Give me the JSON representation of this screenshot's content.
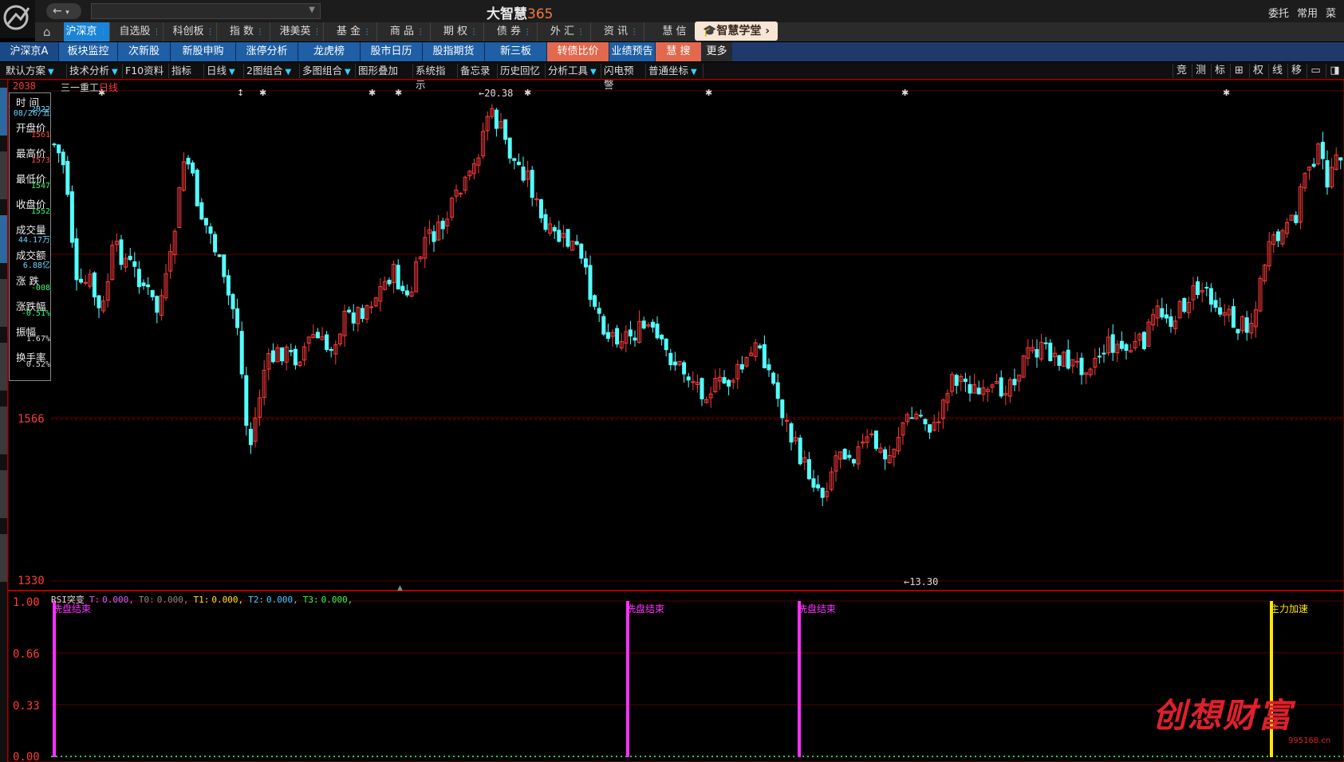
{
  "window": {
    "title_main": "大智慧",
    "title_num": "365",
    "right_links": [
      "委托",
      "常用",
      "菜单"
    ],
    "nav_arrow": "←"
  },
  "market_tabs": [
    {
      "label": "沪深京",
      "active": true
    },
    {
      "label": "自选股",
      "active": false
    },
    {
      "label": "科创板",
      "active": false
    },
    {
      "label": "指  数",
      "active": false
    },
    {
      "label": "港美英",
      "active": false
    },
    {
      "label": "基  金",
      "active": false
    },
    {
      "label": "商  品",
      "active": false
    },
    {
      "label": "期  权",
      "active": false
    },
    {
      "label": "债  券",
      "active": false
    },
    {
      "label": "外  汇",
      "active": false
    },
    {
      "label": "资  讯",
      "active": false
    },
    {
      "label": "慧  信",
      "active": false
    }
  ],
  "academy_button": "智慧学堂",
  "board_tabs": [
    {
      "label": "沪深京A",
      "style": "first"
    },
    {
      "label": "板块监控",
      "style": ""
    },
    {
      "label": "次新股",
      "style": ""
    },
    {
      "label": "新股申购",
      "style": ""
    },
    {
      "label": "涨停分析",
      "style": ""
    },
    {
      "label": "龙虎榜",
      "style": ""
    },
    {
      "label": "股市日历",
      "style": ""
    },
    {
      "label": "股指期货",
      "style": ""
    },
    {
      "label": "新三板",
      "style": ""
    },
    {
      "label": "转债比价",
      "style": "hl"
    },
    {
      "label": "业绩预告",
      "style": ""
    },
    {
      "label": "慧  搜",
      "style": "hl"
    },
    {
      "label": "更多",
      "style": "dark"
    }
  ],
  "tools": [
    {
      "label": "默认方案",
      "tri": true
    },
    {
      "label": "技术分析",
      "tri": true
    },
    {
      "label": "F10资料",
      "tri": false
    },
    {
      "label": "指标",
      "tri": false
    },
    {
      "label": "日线",
      "tri": true
    },
    {
      "label": "2图组合",
      "tri": true
    },
    {
      "label": "多图组合",
      "tri": true
    },
    {
      "label": "图形叠加",
      "tri": false
    },
    {
      "label": "系统指示",
      "tri": false
    },
    {
      "label": "备忘录",
      "tri": false
    },
    {
      "label": "历史回忆",
      "tri": false
    },
    {
      "label": "分析工具",
      "tri": true
    },
    {
      "label": "闪电预警",
      "tri": false
    },
    {
      "label": "普通坐标",
      "tri": true
    }
  ],
  "right_tools": [
    "竞",
    "测",
    "标",
    "⊞",
    "权",
    "线",
    "移",
    "▭",
    "◨"
  ],
  "stock": {
    "name": "三一重工",
    "period": "日线",
    "high_marker": "20.38",
    "low_marker": "13.30",
    "y_labels": [
      "1566",
      "1330"
    ],
    "y_top_partial": "2038"
  },
  "info_panel": [
    {
      "label": "时 间",
      "value": "2022",
      "color": "#6fd6ff"
    },
    {
      "label": "",
      "value": "08/26/五",
      "color": "#6fd6ff"
    },
    {
      "label": "开盘价",
      "value": "1561",
      "color": "#ff4a4a"
    },
    {
      "label": "最高价",
      "value": "1573",
      "color": "#ff4a4a"
    },
    {
      "label": "最低价",
      "value": "1547",
      "color": "#3aff7a"
    },
    {
      "label": "收盘价",
      "value": "1552",
      "color": "#3aff7a"
    },
    {
      "label": "成交量",
      "value": "44.17万",
      "color": "#6fd6ff"
    },
    {
      "label": "成交额",
      "value": "6.88亿",
      "color": "#6fd6ff"
    },
    {
      "label": "涨 跌",
      "value": "-008",
      "color": "#3aff7a"
    },
    {
      "label": "涨跌幅",
      "value": "-0.51%",
      "color": "#3aff7a"
    },
    {
      "label": "振幅",
      "value": "1.67%",
      "color": "#ddd"
    },
    {
      "label": "换手率",
      "value": "0.52%",
      "color": "#ddd"
    }
  ],
  "indicator": {
    "name": "RSI突变",
    "params": [
      {
        "label": "T:",
        "value": "0.000,",
        "color": "#d060ff"
      },
      {
        "label": "T0:",
        "value": "0.000,",
        "color": "#888"
      },
      {
        "label": "T1:",
        "value": "0.000,",
        "color": "#ffe600"
      },
      {
        "label": "T2:",
        "value": "0.000,",
        "color": "#3ad0ff"
      },
      {
        "label": "T3:",
        "value": "0.000,",
        "color": "#3aff3a"
      }
    ],
    "y_labels": [
      "1.00",
      "0.66",
      "0.33",
      "0.00"
    ],
    "signals": [
      {
        "label": "洗盘结束",
        "color": "#ff30ff"
      },
      {
        "label": "洗盘结束",
        "color": "#ff30ff"
      },
      {
        "label": "洗盘结束",
        "color": "#ff30ff"
      },
      {
        "label": "主力加速",
        "color": "#ffe600"
      }
    ]
  },
  "watermark": {
    "text": "创想财富",
    "url": "995168.cn"
  },
  "colors": {
    "up": "#ff3a3a",
    "down": "#54ffff",
    "grid": "#5a0000",
    "axis": "#b00000"
  }
}
